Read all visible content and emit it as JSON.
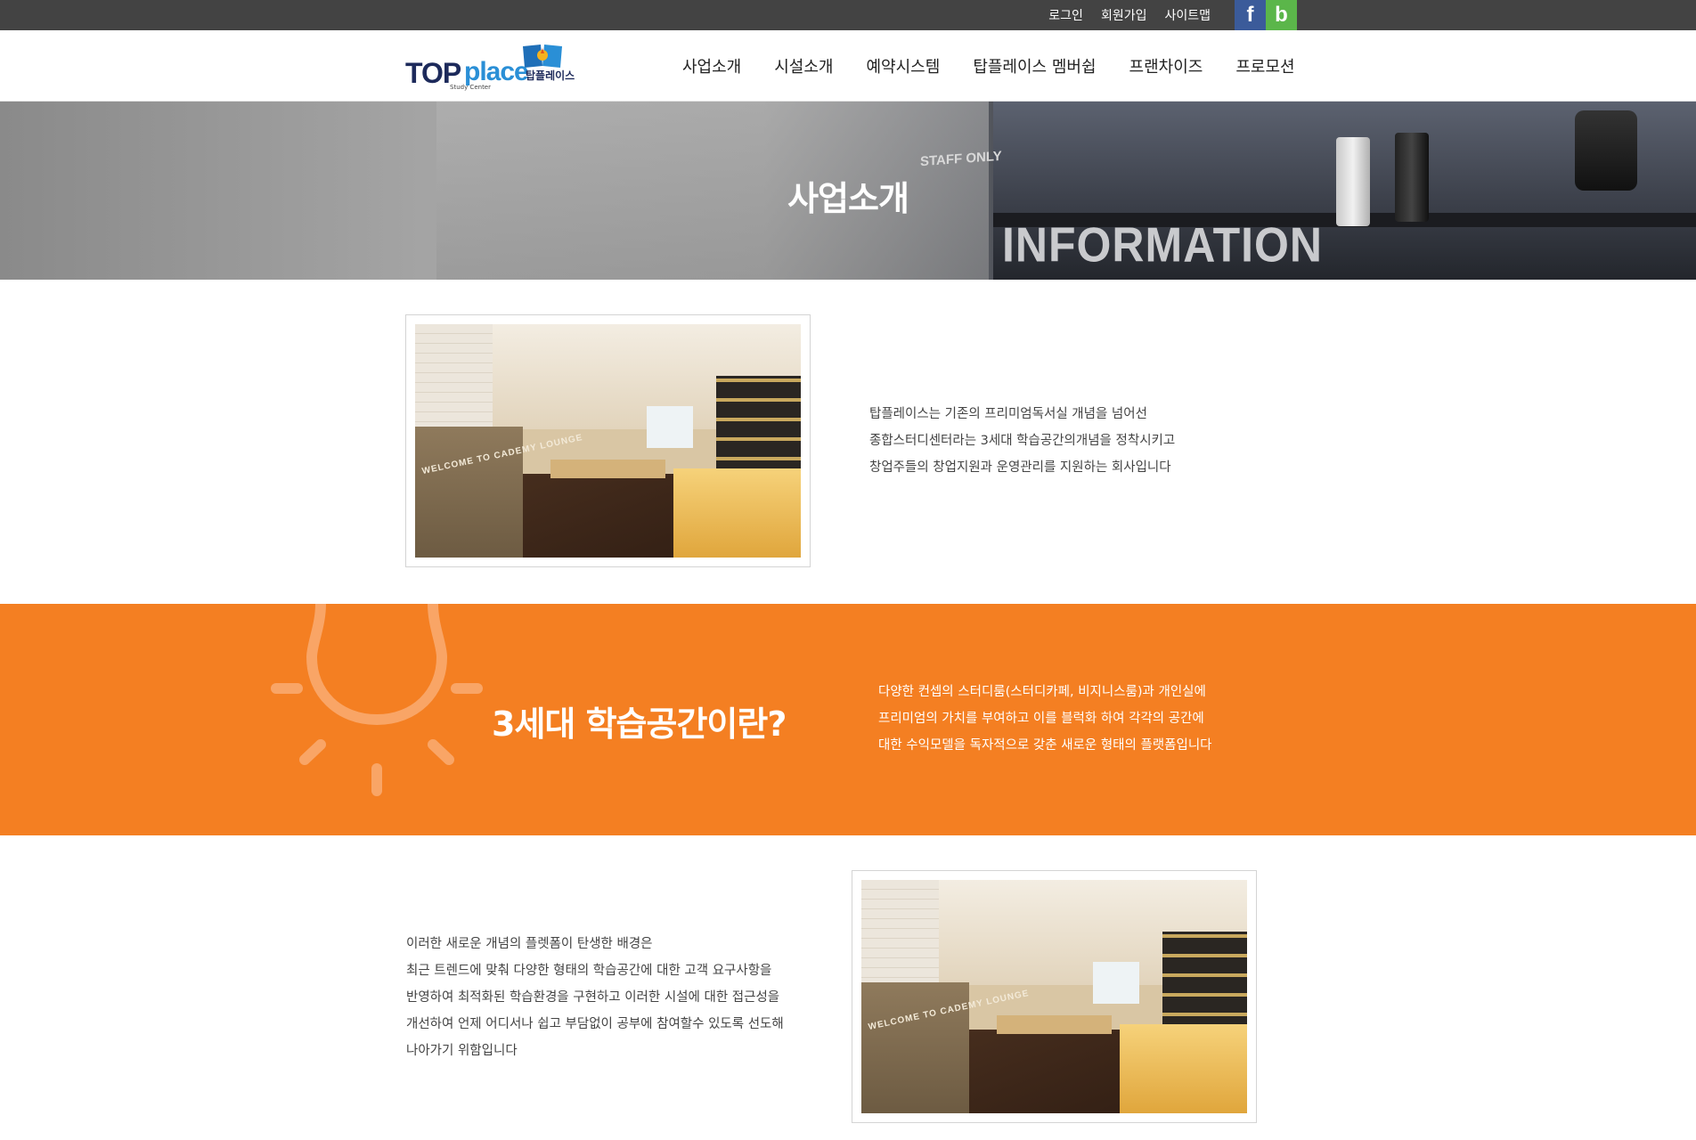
{
  "topbar": {
    "links": [
      "로그인",
      "회원가입",
      "사이트맵"
    ],
    "facebook_icon": "f",
    "blog_icon": "b"
  },
  "header": {
    "logo": {
      "main": "TOP",
      "accent": "place",
      "subtitle": "Study Center",
      "korean": "탑플레이스"
    },
    "nav": [
      "사업소개",
      "시설소개",
      "예약시스템",
      "탑플레이스 멤버쉽",
      "프랜차이즈",
      "프로모션"
    ]
  },
  "hero": {
    "title": "사업소개",
    "sign_staff": "STAFF ONLY",
    "sign_information": "INFORMATION"
  },
  "intro": {
    "photo_caption": "WELCOME TO CADEMY LOUNGE",
    "lines": [
      "탑플레이스는 기존의 프리미엄독서실 개념을 넘어선",
      "종합스터디센터라는 3세대 학습공간의개념을 정착시키고",
      "창업주들의 창업지원과 운영관리를 지원하는 회사입니다"
    ]
  },
  "concept": {
    "heading": "3세대 학습공간이란?",
    "lines": [
      "다양한 컨셉의 스터디룸(스터디카페, 비지니스룸)과 개인실에",
      "프리미엄의 가치를 부여하고 이를 블럭화 하여 각각의 공간에",
      "대한 수익모델을 독자적으로 갖춘 새로운 형태의 플랫폼입니다"
    ],
    "accent_color": "#f47f22"
  },
  "background": {
    "photo_caption": "WELCOME TO CADEMY LOUNGE",
    "lines": [
      "이러한 새로운 개념의 플렛폼이 탄생한 배경은",
      "최근 트렌드에 맞춰 다양한 형태의 학습공간에 대한 고객 요구사항을",
      "반영하여 최적화된 학습환경을 구현하고 이러한 시설에 대한 접근성을",
      "개선하여 언제 어디서나 쉽고 부담없이 공부에 참여할수 있도록 선도해",
      "나아가기 위함입니다"
    ]
  }
}
